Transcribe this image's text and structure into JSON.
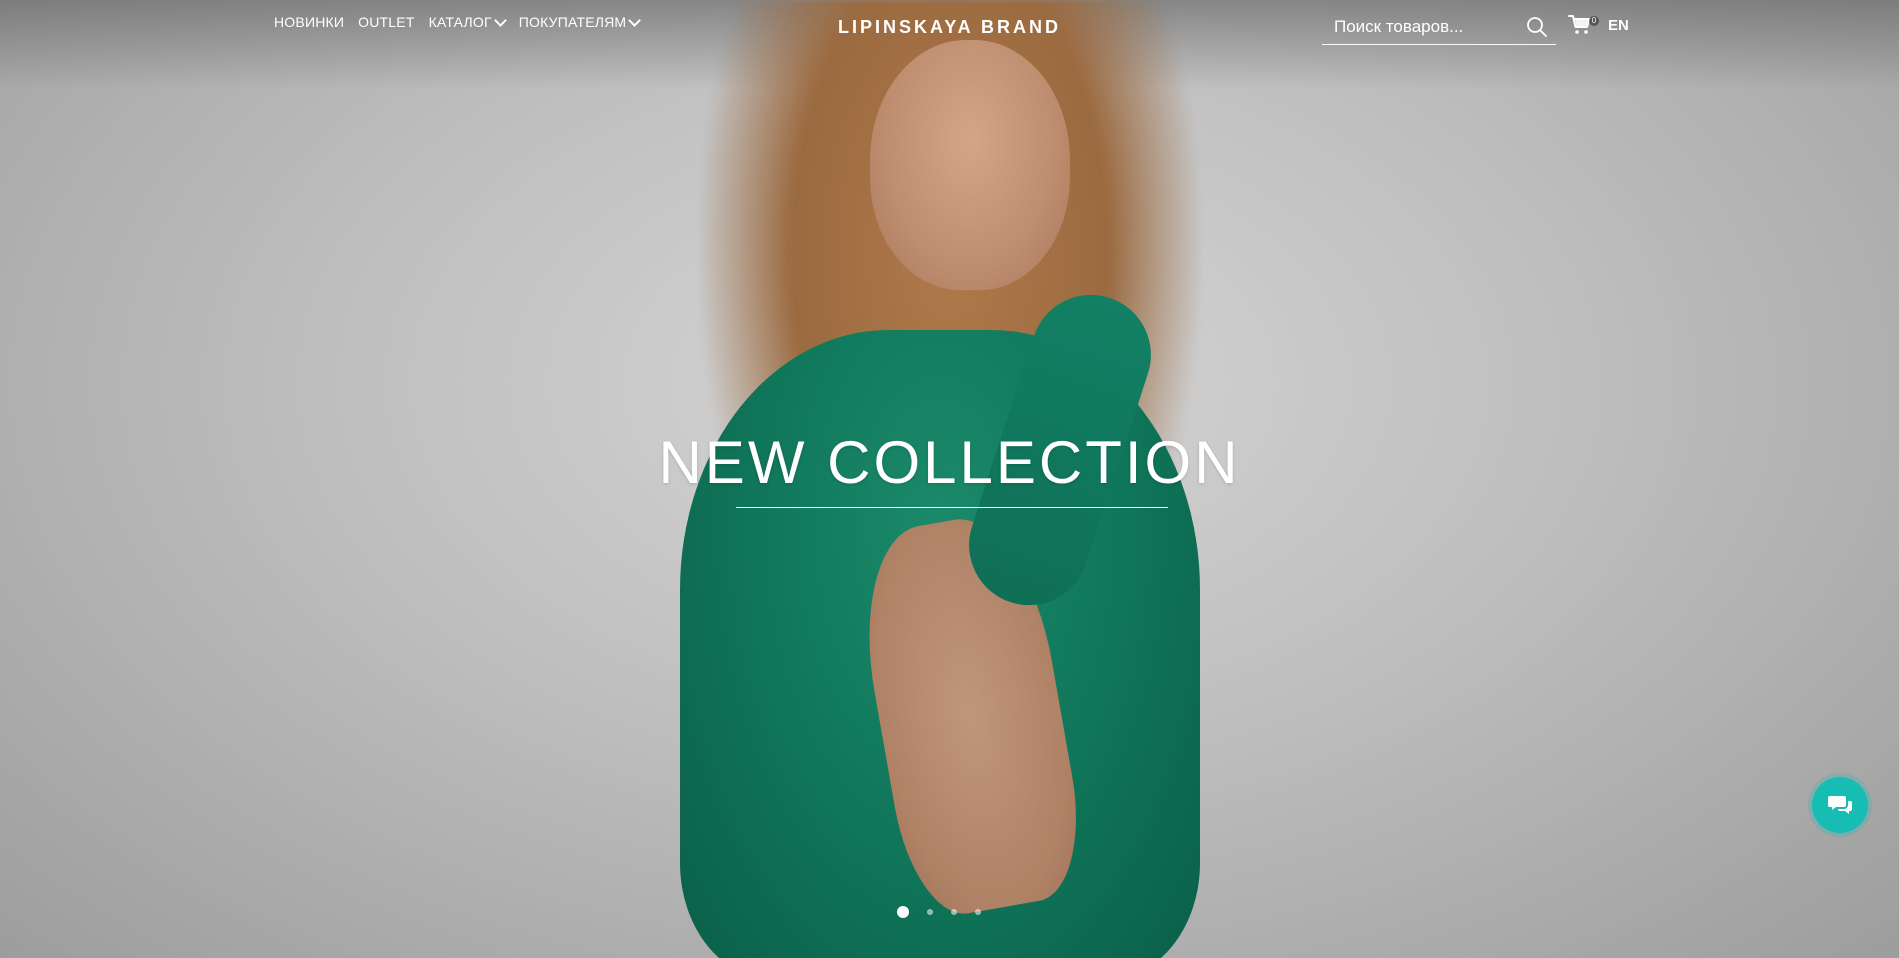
{
  "nav": {
    "items": [
      {
        "label": "НОВИНКИ",
        "dropdown": false
      },
      {
        "label": "OUTLET",
        "dropdown": false
      },
      {
        "label": "КАТАЛОГ",
        "dropdown": true
      },
      {
        "label": "ПОКУПАТЕЛЯМ",
        "dropdown": true
      }
    ]
  },
  "brand": {
    "name": "LIPINSKAYA BRAND"
  },
  "search": {
    "placeholder": "Поиск товаров...",
    "icon": "search-icon"
  },
  "cart": {
    "count": "0",
    "icon": "cart-icon"
  },
  "language": {
    "label": "EN"
  },
  "hero": {
    "title": "NEW COLLECTION"
  },
  "slider": {
    "total": 4,
    "active_index": 0
  },
  "chat": {
    "icon": "chat-icon",
    "color": "#17bdb3"
  }
}
